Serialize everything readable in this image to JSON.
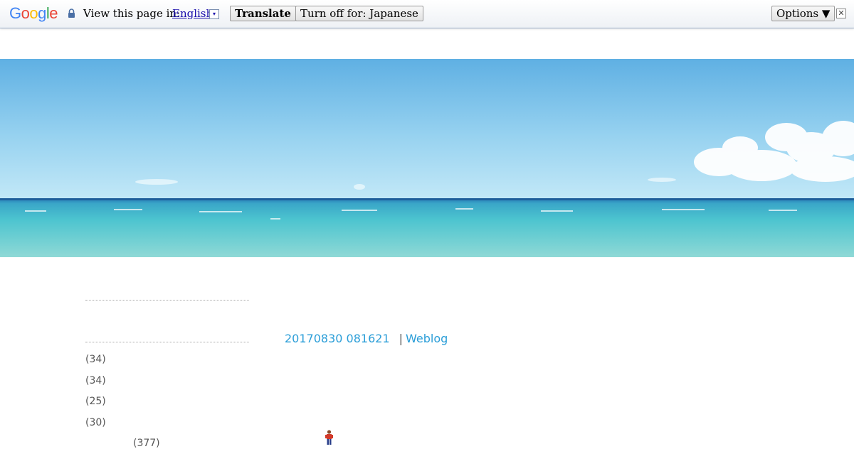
{
  "translate_bar": {
    "logo_letters": [
      {
        "ch": "G",
        "color": "#4285F4"
      },
      {
        "ch": "o",
        "color": "#EA4335"
      },
      {
        "ch": "o",
        "color": "#FBBC05"
      },
      {
        "ch": "g",
        "color": "#4285F4"
      },
      {
        "ch": "l",
        "color": "#34A853"
      },
      {
        "ch": "e",
        "color": "#EA4335"
      }
    ],
    "view_label": "View this page in:",
    "language": "English",
    "caret": "▾",
    "translate_label": "Translate",
    "turn_off_label": "Turn off for: Japanese",
    "options_label": "Options ▼",
    "close_glyph": "✕"
  },
  "sidebar": {
    "counts": [
      "(34)",
      "(34)",
      "(25)",
      "(30)",
      "(377)"
    ]
  },
  "post": {
    "date": "20170830 081621",
    "separator": "|",
    "category": "Weblog"
  },
  "icons": {
    "lock": "lock-icon",
    "person": "person-icon"
  }
}
